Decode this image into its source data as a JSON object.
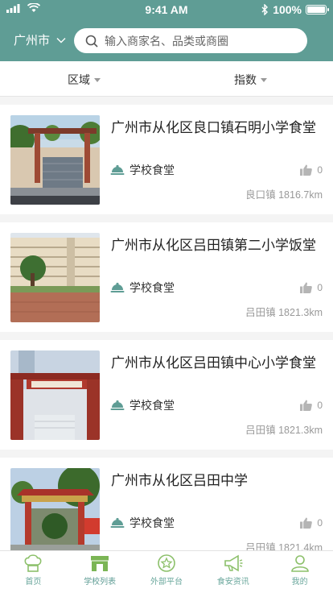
{
  "status": {
    "time": "9:41 AM",
    "battery": "100%"
  },
  "header": {
    "city": "广州市",
    "search_placeholder": "输入商家名、品类或商圈"
  },
  "filters": {
    "area": "区域",
    "index": "指数"
  },
  "restaurants": [
    {
      "name": "广州市从化区良口镇石明小学食堂",
      "category": "学校食堂",
      "likes": "0",
      "location": "良口镇 1816.7km"
    },
    {
      "name": "广州市从化区吕田镇第二小学饭堂",
      "category": "学校食堂",
      "likes": "0",
      "location": "吕田镇 1821.3km"
    },
    {
      "name": "广州市从化区吕田镇中心小学食堂",
      "category": "学校食堂",
      "likes": "0",
      "location": "吕田镇 1821.3km"
    },
    {
      "name": "广州市从化区吕田中学",
      "category": "学校食堂",
      "likes": "0",
      "location": "吕田镇 1821.4km"
    }
  ],
  "tabs": [
    {
      "label": "首页",
      "icon": "chef-hat-icon"
    },
    {
      "label": "学校列表",
      "icon": "school-store-icon"
    },
    {
      "label": "外部平台",
      "icon": "star-badge-icon"
    },
    {
      "label": "食安资讯",
      "icon": "megaphone-icon"
    },
    {
      "label": "我的",
      "icon": "user-icon"
    }
  ],
  "active_tab": "学校列表",
  "colors": {
    "primary": "#5f9d95",
    "tab_icon": "#8cc06a"
  }
}
